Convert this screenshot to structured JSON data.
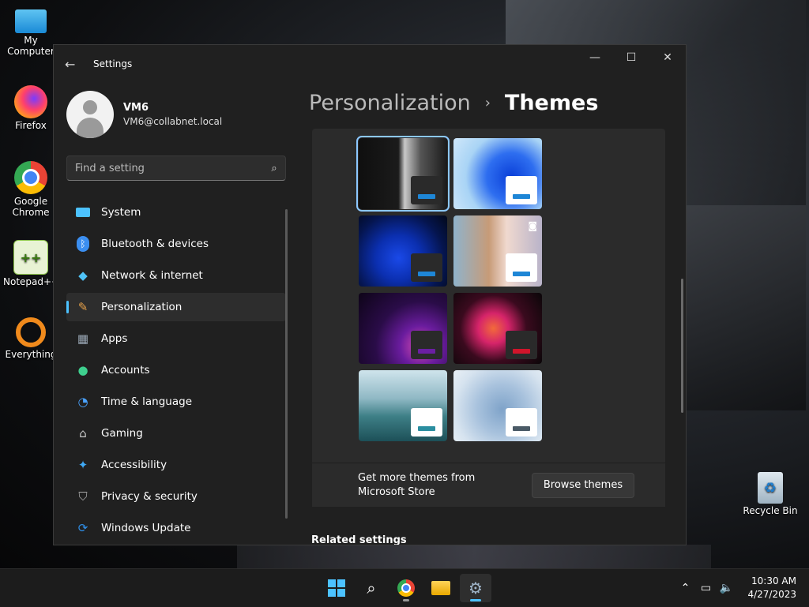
{
  "desktop": {
    "icons": [
      {
        "label": "My Computer"
      },
      {
        "label": "Firefox"
      },
      {
        "label": "Google Chrome"
      },
      {
        "label": "Notepad++"
      },
      {
        "label": "Everything"
      },
      {
        "label": "Recycle Bin"
      }
    ]
  },
  "window": {
    "title": "Settings",
    "back_icon": "arrow-left-icon",
    "controls": [
      "minimize-icon",
      "maximize-icon",
      "close-icon"
    ]
  },
  "user": {
    "name": "VM6",
    "email": "VM6@collabnet.local"
  },
  "search": {
    "placeholder": "Find a setting",
    "value": ""
  },
  "nav": {
    "items": [
      {
        "label": "System",
        "icon": "display-icon",
        "color": "#4cc2ff"
      },
      {
        "label": "Bluetooth & devices",
        "icon": "bluetooth-icon",
        "color": "#3b8ef0"
      },
      {
        "label": "Network & internet",
        "icon": "wifi-icon",
        "color": "#4fc3f7"
      },
      {
        "label": "Personalization",
        "icon": "brush-icon",
        "color": "#e8a24a",
        "active": true
      },
      {
        "label": "Apps",
        "icon": "apps-icon",
        "color": "#9aa7b5"
      },
      {
        "label": "Accounts",
        "icon": "person-icon",
        "color": "#3ecf8e"
      },
      {
        "label": "Time & language",
        "icon": "clock-globe-icon",
        "color": "#4aa3ff"
      },
      {
        "label": "Gaming",
        "icon": "gamepad-icon",
        "color": "#c9c9c9"
      },
      {
        "label": "Accessibility",
        "icon": "accessibility-icon",
        "color": "#3fa9f5"
      },
      {
        "label": "Privacy & security",
        "icon": "shield-icon",
        "color": "#a8a8a8"
      },
      {
        "label": "Windows Update",
        "icon": "update-icon",
        "color": "#2f8de4"
      }
    ]
  },
  "breadcrumb": {
    "parent": "Personalization",
    "separator": "›",
    "current": "Themes"
  },
  "themes": [
    {
      "name": "current-custom",
      "selected": true,
      "accent": "#1e86d6",
      "swatch": "dark",
      "bg": "linear-gradient(90deg,#0f0f0f 0%,#1b1b1b 45%,#c9c9c9 52%,#555 70%,#1a1a1a 100%)"
    },
    {
      "name": "windows-light",
      "accent": "#1e86d6",
      "swatch": "light",
      "bg": "radial-gradient(circle at 65% 55%,#0a3fd8 0%,#2e6ef0 35%,#a9d4f5 65%,#cfe7fa 100%)"
    },
    {
      "name": "windows-dark",
      "accent": "#1e86d6",
      "swatch": "dark",
      "bg": "radial-gradient(circle at 45% 60%,#1a49e8 0%,#0b2fb0 35%,#05154f 70%,#020818 100%)"
    },
    {
      "name": "captured-motion",
      "accent": "#1e86d6",
      "swatch": "light",
      "camera": true,
      "bg": "linear-gradient(90deg,#8fb3cc 0%,#c79b78 40%,#f0d9cf 60%,#b9b3c9 100%)"
    },
    {
      "name": "glow",
      "accent": "#6b1fa3",
      "swatch": "dark",
      "bg": "radial-gradient(circle at 70% 75%,#d94bb0 0%,#6a1c9e 25%,#2a0c48 55%,#0e0418 100%)"
    },
    {
      "name": "flow",
      "accent": "#d0152b",
      "swatch": "dark",
      "bg": "radial-gradient(circle at 45% 50%,#f26a3a 0%,#d6246a 25%,#3a0a1e 55%,#0a0608 100%)"
    },
    {
      "name": "sunrise",
      "accent": "#2a8ea0",
      "swatch": "light",
      "bg": "linear-gradient(180deg,#cfe4ec 0%,#8fb8c4 40%,#3d7f86 65%,#1d5058 100%)"
    },
    {
      "name": "windows-bloom",
      "accent": "#4a5a66",
      "swatch": "light",
      "bg": "radial-gradient(circle at 55% 55%,#7fa3c9 0%,#a8c2dd 40%,#d6e3ef 75%,#e9f0f6 100%)"
    }
  ],
  "store": {
    "text": "Get more themes from Microsoft Store",
    "button": "Browse themes"
  },
  "related": {
    "label": "Related settings"
  },
  "taskbar": {
    "apps": [
      "start-icon",
      "search-icon",
      "chrome-icon",
      "file-explorer-icon",
      "settings-icon"
    ],
    "active_app": "settings-icon",
    "tray": [
      "chevron-up-icon",
      "network-icon",
      "volume-icon"
    ],
    "time": "10:30 AM",
    "date": "4/27/2023"
  }
}
